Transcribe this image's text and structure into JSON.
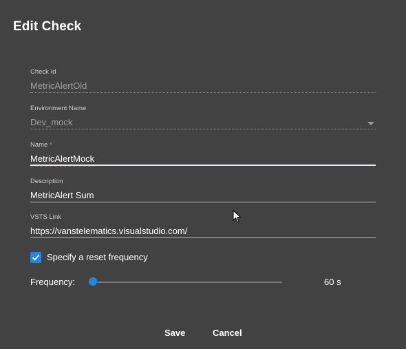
{
  "dialog": {
    "title": "Edit Check",
    "fields": {
      "check_id": {
        "label": "Check Id",
        "value": "MetricAlertOld"
      },
      "environment": {
        "label": "Environment Name",
        "value": "Dev_mock"
      },
      "name": {
        "label": "Name",
        "required_mark": "*",
        "value": "MetricAlertMock"
      },
      "description": {
        "label": "Description",
        "value": "MetricAlert Sum"
      },
      "vsts_link": {
        "label": "VSTS Link",
        "value": "https://vanstelematics.visualstudio.com/"
      }
    },
    "reset_frequency": {
      "label": "Specify a reset frequency",
      "checked": true
    },
    "frequency": {
      "label": "Frequency:",
      "value_text": "60 s",
      "slider_fraction": 0
    },
    "buttons": {
      "save": "Save",
      "cancel": "Cancel"
    }
  },
  "colors": {
    "background": "#424242",
    "accent": "#1e88e5"
  },
  "icons": {
    "checkbox": "check-icon",
    "dropdown": "dropdown-arrow-icon",
    "cursor": "mouse-pointer-icon"
  }
}
